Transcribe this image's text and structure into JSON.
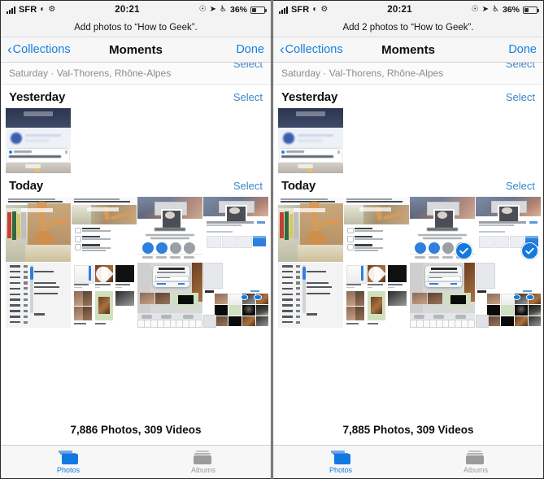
{
  "panels": [
    {
      "id": "before",
      "status": {
        "carrier": "SFR",
        "time": "20:21",
        "battery_pct": "36%",
        "icons": [
          "signal-bars-icon",
          "wifi-icon",
          "sync-spinner-icon",
          "alarm-icon",
          "location-arrow-icon",
          "headphones-icon",
          "battery-icon"
        ]
      },
      "banner": "Add photos to “How to Geek”.",
      "nav": {
        "back": "Collections",
        "title": "Moments",
        "done": "Done"
      },
      "clipped_moment": {
        "day": "Saturday",
        "separator": "·",
        "place": "Val-Thorens, Rhône-Alpes",
        "select": "Select"
      },
      "sections": [
        {
          "title": "Yesterday",
          "select": "Select",
          "thumbs": [
            "chat-notification-screenshot"
          ],
          "selected": []
        },
        {
          "title": "Today",
          "select": "Select",
          "thumbs": [
            "dinosaur-store-photo",
            "facebook-menu-screenshot",
            "facebook-profile-screenshot",
            "facebook-post-screenshot",
            "weather-list-screenshot",
            "photos-collage-screenshot",
            "new-album-dialog-screenshot",
            "moments-picker-screenshot"
          ],
          "selected": []
        }
      ],
      "count": "7,886 Photos, 309 Videos",
      "tabs": [
        {
          "label": "Photos",
          "icon": "photos-icon",
          "active": true
        },
        {
          "label": "Albums",
          "icon": "albums-icon",
          "active": false
        }
      ]
    },
    {
      "id": "after",
      "status": {
        "carrier": "SFR",
        "time": "20:21",
        "battery_pct": "36%",
        "icons": [
          "signal-bars-icon",
          "wifi-icon",
          "sync-spinner-icon",
          "alarm-icon",
          "location-arrow-icon",
          "headphones-icon",
          "battery-icon"
        ]
      },
      "banner": "Add 2 photos to “How to Geek”.",
      "nav": {
        "back": "Collections",
        "title": "Moments",
        "done": "Done"
      },
      "clipped_moment": {
        "day": "Saturday",
        "separator": "·",
        "place": "Val-Thorens, Rhône-Alpes",
        "select": "Select"
      },
      "sections": [
        {
          "title": "Yesterday",
          "select": "Select",
          "thumbs": [
            "chat-notification-screenshot"
          ],
          "selected": []
        },
        {
          "title": "Today",
          "select": "Select",
          "thumbs": [
            "dinosaur-store-photo",
            "facebook-menu-screenshot",
            "facebook-profile-screenshot",
            "facebook-post-screenshot",
            "weather-list-screenshot",
            "photos-collage-screenshot",
            "new-album-dialog-screenshot",
            "moments-picker-screenshot"
          ],
          "selected": [
            2,
            3
          ]
        }
      ],
      "count": "7,885 Photos, 309 Videos",
      "tabs": [
        {
          "label": "Photos",
          "icon": "photos-icon",
          "active": true
        },
        {
          "label": "Albums",
          "icon": "albums-icon",
          "active": false
        }
      ]
    }
  ],
  "colors": {
    "accent_blue": "#1279e0",
    "link_blue": "#1a7ddc",
    "select_blue": "#3d85c6",
    "nav_bg": "#f7f7f7",
    "banner_bg": "#f3f3f3",
    "tab_inactive": "#9a9a9a",
    "frame": "#2b2b2b"
  }
}
